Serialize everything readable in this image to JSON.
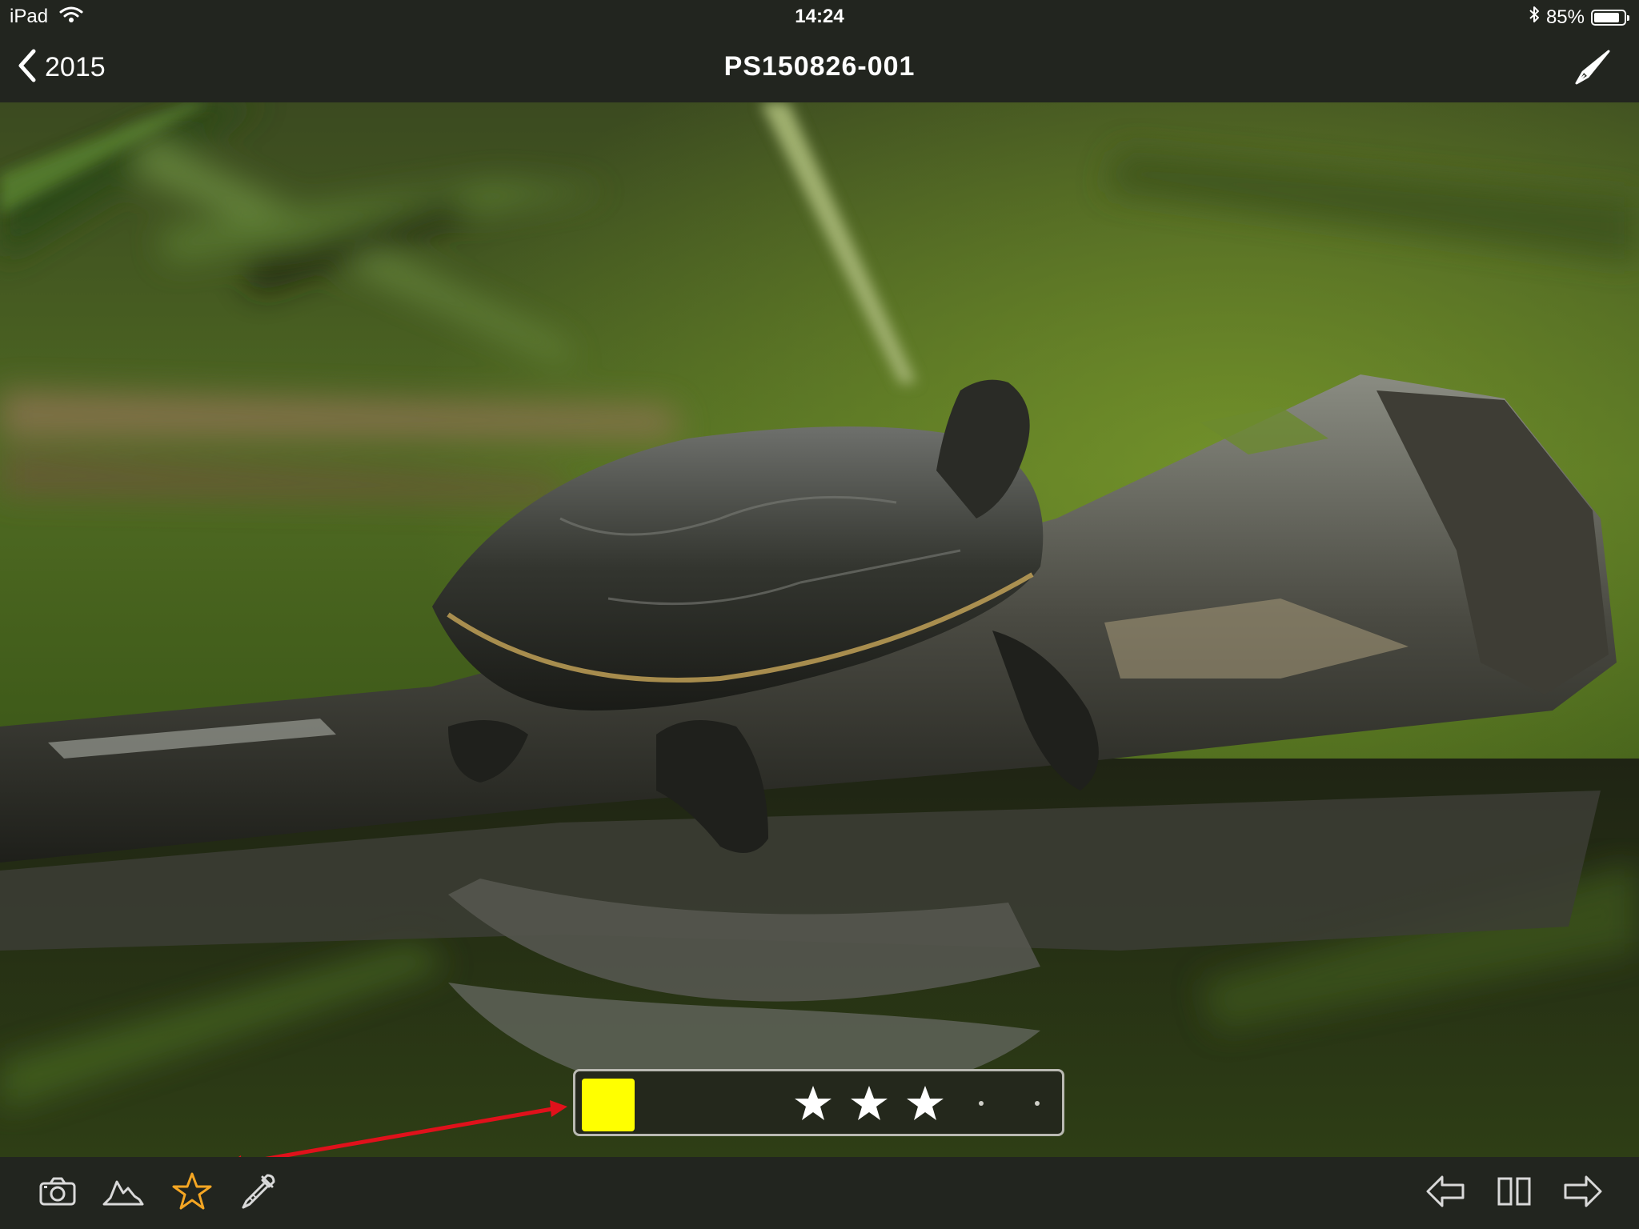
{
  "status_bar": {
    "device": "iPad",
    "time": "14:24",
    "battery_text": "85%",
    "battery_level": 0.85,
    "icons": [
      "wifi-icon",
      "bluetooth-icon",
      "battery-icon"
    ]
  },
  "nav": {
    "back_label": "2015",
    "title": "PS150826-001",
    "icons": [
      "chevron-left-icon",
      "compose-icon"
    ]
  },
  "rating": {
    "color_label": "#ffff00",
    "stars": 3,
    "max_stars": 5
  },
  "toolbar": {
    "left_icons": [
      "camera-icon",
      "histogram-icon",
      "star-icon",
      "eyedropper-icon"
    ],
    "right_icons": [
      "arrow-left-icon",
      "split-view-icon",
      "arrow-right-icon"
    ],
    "active_icon": "star-icon"
  },
  "colors": {
    "bar_background": "#22251f",
    "active_icon": "#f5a623",
    "annotation_arrow": "#e0111b",
    "star_fill": "#ffffff"
  }
}
